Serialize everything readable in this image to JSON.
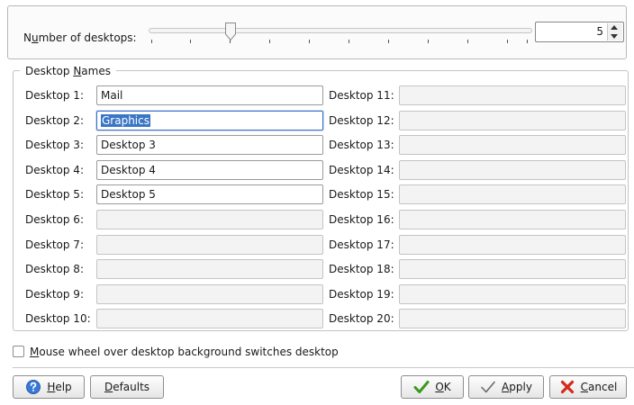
{
  "top": {
    "number_label_prefix": "N",
    "number_label_mnemonic": "u",
    "number_label_rest": "mber of desktops:",
    "number_of_desktops": "5",
    "slider_min": 1,
    "slider_max": 20,
    "slider_value": 5
  },
  "names_group": {
    "title_prefix": "Desktop ",
    "title_mnemonic": "N",
    "title_rest": "ames"
  },
  "desktops": [
    {
      "label": "Desktop 1:",
      "value": "Mail"
    },
    {
      "label": "Desktop 2:",
      "value": "Graphics"
    },
    {
      "label": "Desktop 3:",
      "value": "Desktop 3"
    },
    {
      "label": "Desktop 4:",
      "value": "Desktop 4"
    },
    {
      "label": "Desktop 5:",
      "value": "Desktop 5"
    },
    {
      "label": "Desktop 6:",
      "value": ""
    },
    {
      "label": "Desktop 7:",
      "value": ""
    },
    {
      "label": "Desktop 8:",
      "value": ""
    },
    {
      "label": "Desktop 9:",
      "value": ""
    },
    {
      "label": "Desktop 10:",
      "value": ""
    },
    {
      "label": "Desktop 11:",
      "value": ""
    },
    {
      "label": "Desktop 12:",
      "value": ""
    },
    {
      "label": "Desktop 13:",
      "value": ""
    },
    {
      "label": "Desktop 14:",
      "value": ""
    },
    {
      "label": "Desktop 15:",
      "value": ""
    },
    {
      "label": "Desktop 16:",
      "value": ""
    },
    {
      "label": "Desktop 17:",
      "value": ""
    },
    {
      "label": "Desktop 18:",
      "value": ""
    },
    {
      "label": "Desktop 19:",
      "value": ""
    },
    {
      "label": "Desktop 20:",
      "value": ""
    }
  ],
  "mouse_wheel": {
    "mnemonic": "M",
    "rest": "ouse wheel over desktop background switches desktop",
    "checked": false
  },
  "buttons": {
    "help_mnemonic": "H",
    "help_rest": "elp",
    "defaults_mnemonic": "D",
    "defaults_rest": "efaults",
    "ok_mnemonic": "O",
    "ok_rest": "K",
    "apply_mnemonic": "A",
    "apply_rest": "pply",
    "cancel_mnemonic": "C",
    "cancel_rest": "ancel"
  },
  "colors": {
    "selection": "#3b76c6",
    "ok_check": "#3a9a1e",
    "cancel_x": "#d42a1a",
    "help_blue": "#3a78d4"
  },
  "icons": {
    "help": "help-icon",
    "ok": "checkmark-icon",
    "apply": "checkmark-outline-icon",
    "cancel": "cancel-x-icon"
  }
}
